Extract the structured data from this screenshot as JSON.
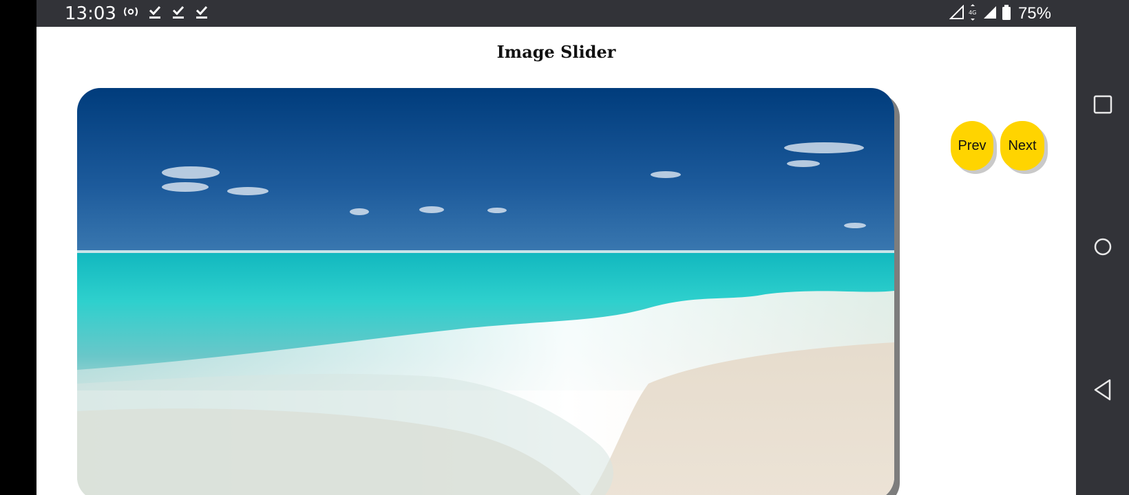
{
  "status_bar": {
    "time": "13:03",
    "battery_percent": "75%",
    "network_label": "4G"
  },
  "page": {
    "title": "Image Slider"
  },
  "slider": {
    "prev_label": "Prev",
    "next_label": "Next",
    "current_image": "beach-scene"
  },
  "colors": {
    "button_fill": "#ffd400",
    "status_bar": "#323338",
    "nav_rail": "#323338"
  }
}
